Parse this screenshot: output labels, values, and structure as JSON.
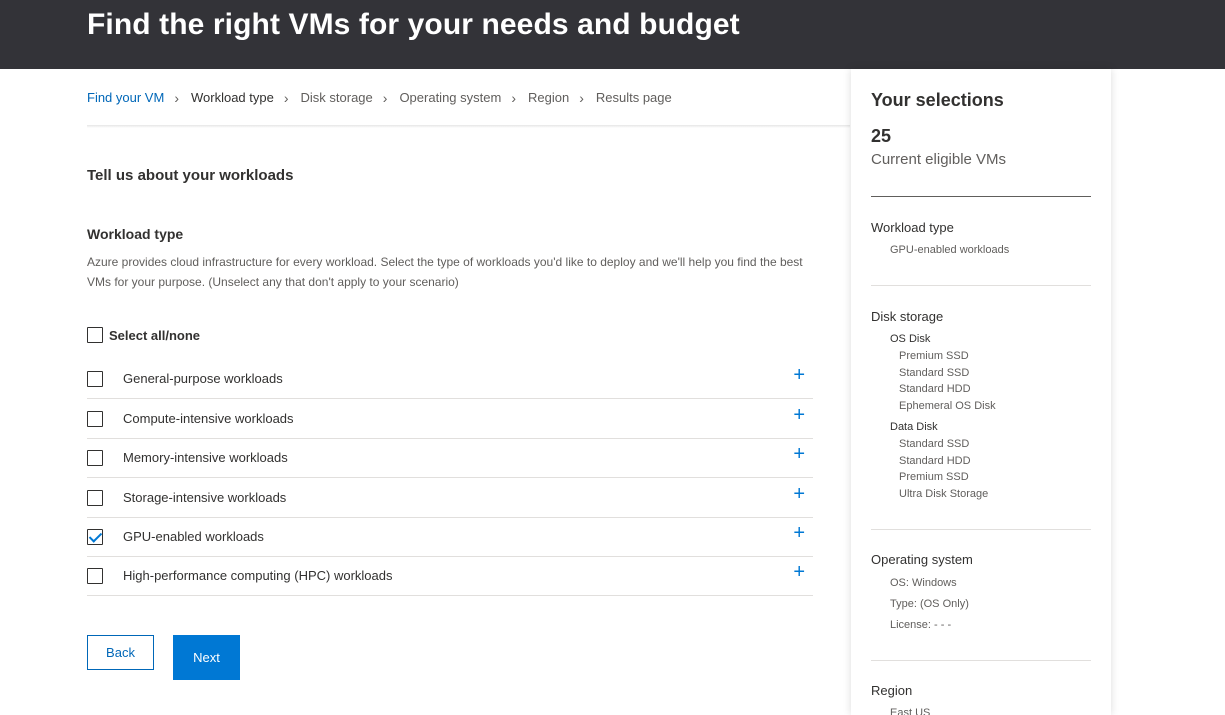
{
  "header": {
    "title": "Find the right VMs for your needs and budget"
  },
  "breadcrumb": {
    "items": [
      {
        "label": "Find your VM"
      },
      {
        "label": "Workload type"
      },
      {
        "label": "Disk storage"
      },
      {
        "label": "Operating system"
      },
      {
        "label": "Region"
      },
      {
        "label": "Results page"
      }
    ],
    "chevron": "›"
  },
  "main": {
    "section_title": "Tell us about your workloads",
    "workload_type_title": "Workload type",
    "workload_type_desc": "Azure provides cloud infrastructure for every workload. Select the type of workloads you'd like to deploy and we'll help you find the best VMs for your purpose. (Unselect any that don't apply to your scenario)",
    "select_all_label": "Select all/none",
    "select_all_checked": false,
    "workloads": [
      {
        "label": "General-purpose workloads",
        "checked": false
      },
      {
        "label": "Compute-intensive workloads",
        "checked": false
      },
      {
        "label": "Memory-intensive workloads",
        "checked": false
      },
      {
        "label": "Storage-intensive workloads",
        "checked": false
      },
      {
        "label": "GPU-enabled workloads",
        "checked": true
      },
      {
        "label": "High-performance computing (HPC) workloads",
        "checked": false
      }
    ],
    "expand_symbol": "+",
    "back_label": "Back",
    "next_label": "Next"
  },
  "panel": {
    "title": "Your selections",
    "count": "25",
    "count_label": "Current eligible VMs",
    "workload_heading": "Workload type",
    "workload_value": "GPU-enabled workloads",
    "disk_heading": "Disk storage",
    "os_disk_label": "OS Disk",
    "os_disk_items": [
      "Premium SSD",
      "Standard SSD",
      "Standard HDD",
      "Ephemeral OS Disk"
    ],
    "data_disk_label": "Data Disk",
    "data_disk_items": [
      "Standard SSD",
      "Standard HDD",
      "Premium SSD",
      "Ultra Disk Storage"
    ],
    "os_heading": "Operating system",
    "os_items": [
      "OS: Windows",
      "Type: (OS Only)",
      "License: - - -"
    ],
    "region_heading": "Region",
    "region_value": "East US"
  },
  "colors": {
    "header_bg": "#333338",
    "accent": "#0078d4",
    "link": "#0067b8"
  }
}
